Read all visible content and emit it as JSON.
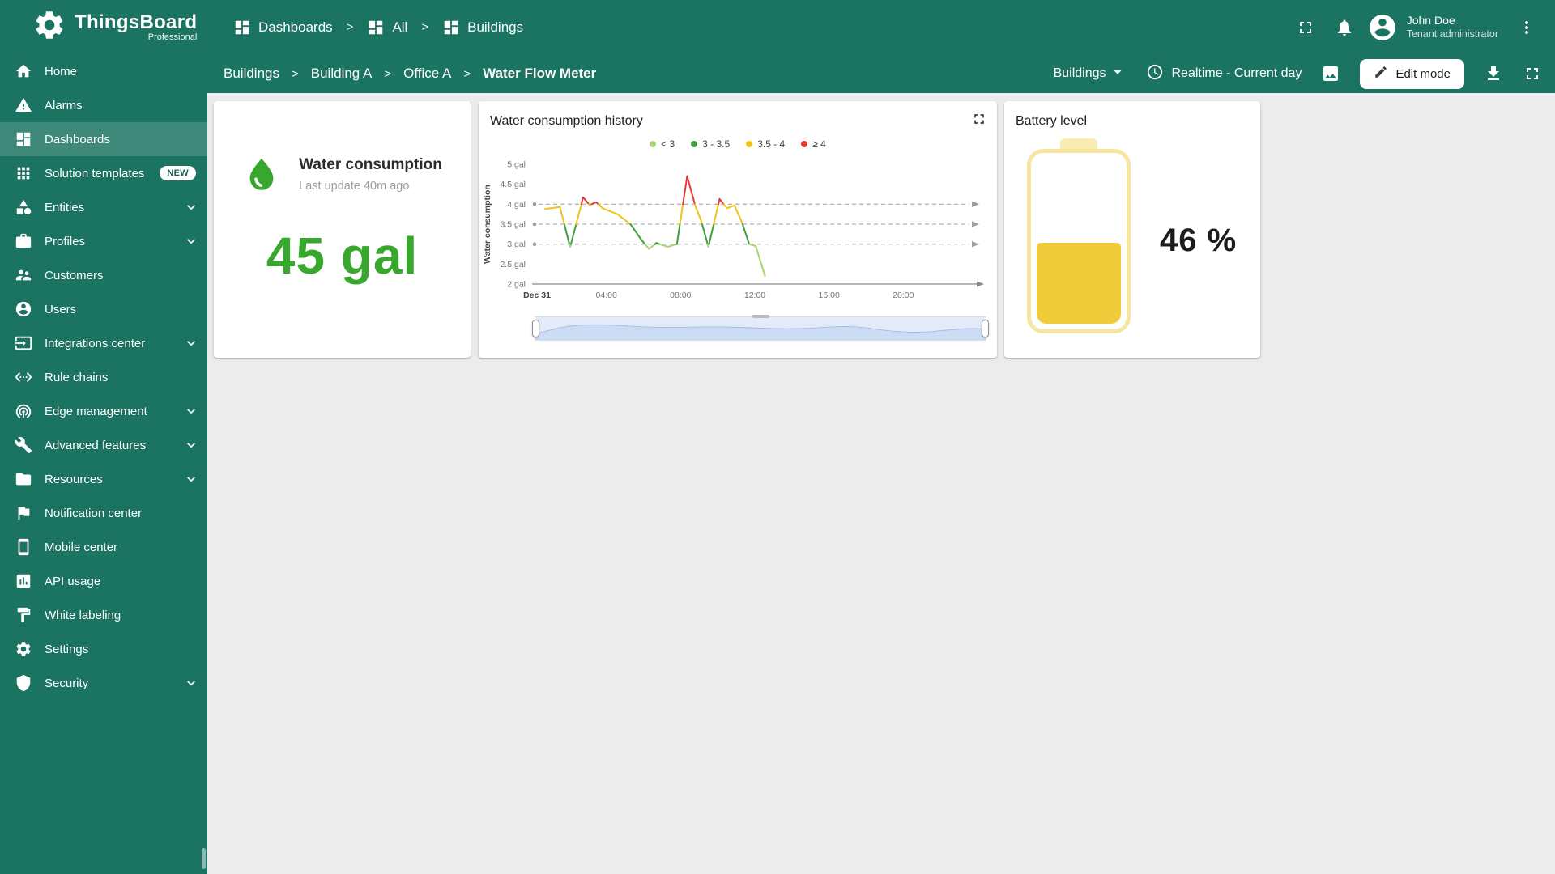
{
  "brand": {
    "name": "ThingsBoard",
    "edition": "Professional"
  },
  "top_header": {
    "breadcrumb": [
      {
        "label": "Dashboards",
        "icon": "dashboards"
      },
      {
        "label": "All",
        "icon": "dashboards"
      },
      {
        "label": "Buildings",
        "icon": "dashboards"
      }
    ],
    "user": {
      "name": "John Doe",
      "role": "Tenant administrator"
    }
  },
  "dashboard_toolbar": {
    "breadcrumb": [
      "Buildings",
      "Building A",
      "Office A",
      "Water Flow Meter"
    ],
    "entity_select": {
      "value": "Buildings"
    },
    "timewindow": {
      "label": "Realtime - Current day",
      "icon": "clock"
    },
    "edit_button": {
      "label": "Edit mode",
      "icon": "edit"
    }
  },
  "sidebar": {
    "items": [
      {
        "label": "Home",
        "icon": "home"
      },
      {
        "label": "Alarms",
        "icon": "alarms"
      },
      {
        "label": "Dashboards",
        "icon": "dashboards",
        "active": true
      },
      {
        "label": "Solution templates",
        "icon": "solution-templates",
        "badge": "NEW"
      },
      {
        "label": "Entities",
        "icon": "entities",
        "expandable": true
      },
      {
        "label": "Profiles",
        "icon": "profiles",
        "expandable": true
      },
      {
        "label": "Customers",
        "icon": "customers"
      },
      {
        "label": "Users",
        "icon": "users"
      },
      {
        "label": "Integrations center",
        "icon": "integrations",
        "expandable": true
      },
      {
        "label": "Rule chains",
        "icon": "rule-chains"
      },
      {
        "label": "Edge management",
        "icon": "edge-management",
        "expandable": true
      },
      {
        "label": "Advanced features",
        "icon": "advanced-features",
        "expandable": true
      },
      {
        "label": "Resources",
        "icon": "resources",
        "expandable": true
      },
      {
        "label": "Notification center",
        "icon": "notification-center"
      },
      {
        "label": "Mobile center",
        "icon": "mobile-center"
      },
      {
        "label": "API usage",
        "icon": "api-usage"
      },
      {
        "label": "White labeling",
        "icon": "white-labeling"
      },
      {
        "label": "Settings",
        "icon": "settings"
      },
      {
        "label": "Security",
        "icon": "security",
        "expandable": true
      }
    ]
  },
  "cards": {
    "water_consumption": {
      "title": "Water consumption",
      "subtitle": "Last update 40m ago",
      "value": "45 gal",
      "accent_color": "#38a72e"
    },
    "battery": {
      "title": "Battery level",
      "value": "46 %",
      "level_percent": 46,
      "fill_color": "#f0cc3a",
      "shell_color": "#f6e6a2"
    }
  },
  "chart_data": {
    "type": "line",
    "title": "Water consumption history",
    "ylabel": "Water consumption",
    "ylim": [
      2,
      5
    ],
    "ytick_values": [
      5,
      4.5,
      4,
      3.5,
      3,
      2.5,
      2
    ],
    "ytick_suffix": " gal",
    "xlim_hours": [
      0,
      24
    ],
    "xticks": [
      {
        "h": 0,
        "label": "Dec 31",
        "bold": true
      },
      {
        "h": 4,
        "label": "04:00"
      },
      {
        "h": 8,
        "label": "08:00"
      },
      {
        "h": 12,
        "label": "12:00"
      },
      {
        "h": 16,
        "label": "16:00"
      },
      {
        "h": 20,
        "label": "20:00"
      }
    ],
    "thresholds": [
      4,
      3.5,
      3
    ],
    "legend": [
      {
        "label": "< 3",
        "color": "#aad475"
      },
      {
        "label": "3 - 3.5",
        "color": "#3f9f40"
      },
      {
        "label": "3.5 - 4",
        "color": "#eec41a"
      },
      {
        "label": "≥ 4",
        "color": "#e53935"
      }
    ],
    "ranges": [
      {
        "max": 3,
        "color": "#aad475"
      },
      {
        "max": 3.5,
        "color": "#3f9f40"
      },
      {
        "max": 4,
        "color": "#eec41a"
      },
      {
        "max": 99,
        "color": "#e53935"
      }
    ],
    "points": [
      [
        0.7,
        3.88
      ],
      [
        1.5,
        3.93
      ],
      [
        2.05,
        2.93
      ],
      [
        2.75,
        4.17
      ],
      [
        3.1,
        3.98
      ],
      [
        3.45,
        4.05
      ],
      [
        3.8,
        3.9
      ],
      [
        4.6,
        3.75
      ],
      [
        5.3,
        3.5
      ],
      [
        5.9,
        3.1
      ],
      [
        6.3,
        2.88
      ],
      [
        6.7,
        3.03
      ],
      [
        7.3,
        2.93
      ],
      [
        7.8,
        3.0
      ],
      [
        8.35,
        4.7
      ],
      [
        8.8,
        3.95
      ],
      [
        9.1,
        3.6
      ],
      [
        9.5,
        2.93
      ],
      [
        10.1,
        4.13
      ],
      [
        10.5,
        3.9
      ],
      [
        10.9,
        3.97
      ],
      [
        11.3,
        3.55
      ],
      [
        11.7,
        3.0
      ],
      [
        12.05,
        2.95
      ],
      [
        12.55,
        2.2
      ]
    ]
  }
}
